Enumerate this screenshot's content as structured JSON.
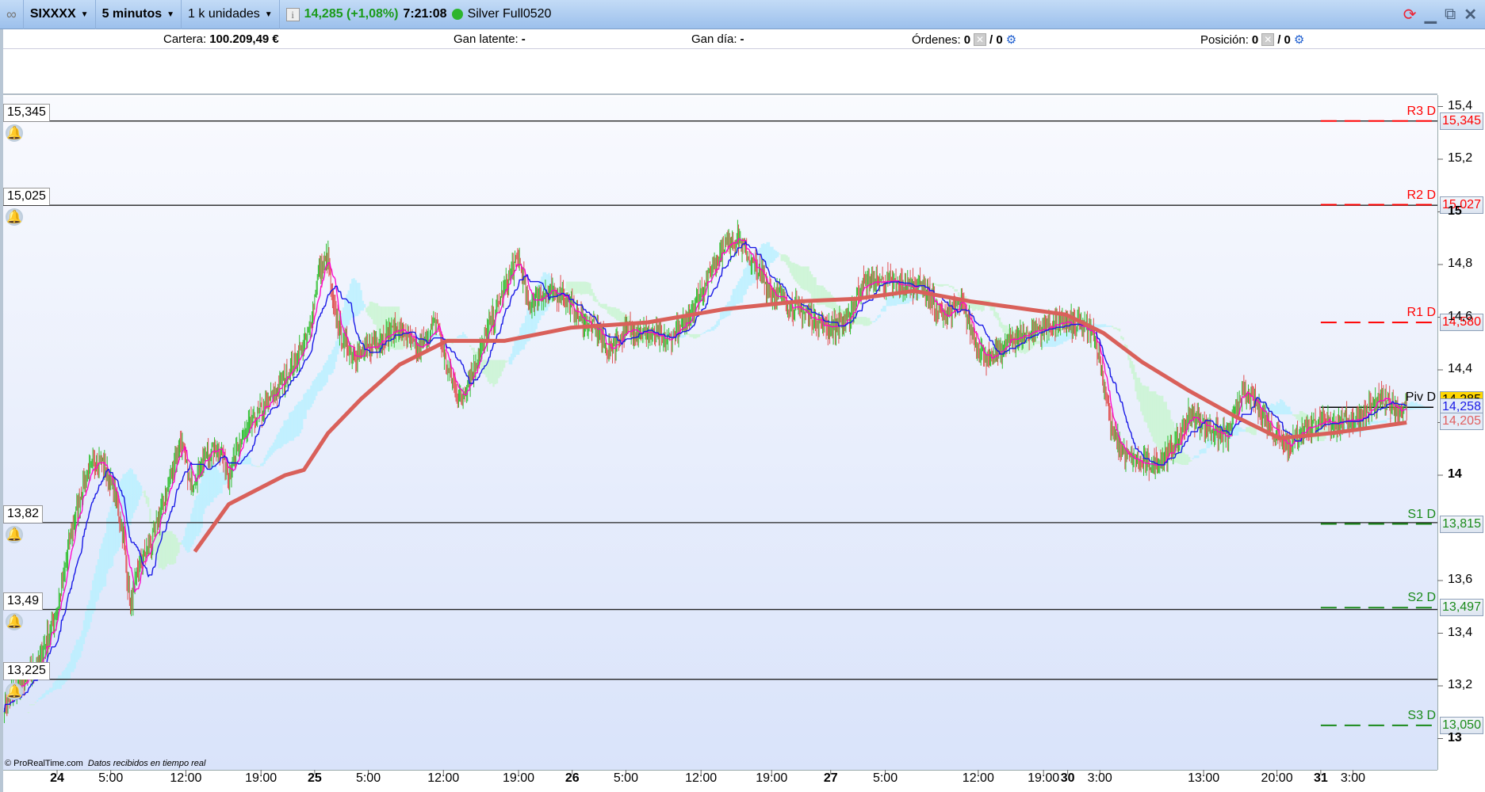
{
  "toolbar": {
    "symbol": "SIXXXX",
    "timeframe": "5 minutos",
    "units": "1 k unidades",
    "price": "14,285 (+1,08%)",
    "time": "7:21:08",
    "account": "Silver Full0520",
    "icons": [
      "link-icon",
      "info-icon",
      "status-dot-icon",
      "refresh-icon",
      "minimize-icon",
      "restore-icon",
      "close-icon"
    ]
  },
  "infobar": {
    "cartera_label": "Cartera:",
    "cartera_value": "100.209,49 €",
    "latente_label": "Gan latente:",
    "latente_value": "-",
    "dia_label": "Gan día:",
    "dia_value": "-",
    "ordenes_label": "Órdenes:",
    "ordenes_value": "0",
    "ordenes_total": "/ 0",
    "posicion_label": "Posición:",
    "posicion_value": "0",
    "posicion_total": "/ 0"
  },
  "footer": {
    "copyright": "© ProRealTime.com",
    "status": "Datos recibidos en tiempo real"
  },
  "colors": {
    "up": "#2fbf2f",
    "down": "#e05050",
    "ma": "#d9605a",
    "tenkan": "#1a1ae6",
    "fast": "#ff00cc",
    "cloud_a": "#b8f0ff",
    "cloud_b": "#c8f5d0",
    "resistance": "#ff0000",
    "support": "#1a8a1a",
    "price_tag": "#ffd700"
  },
  "chart_data": {
    "type": "line",
    "title": "SIXXXX 5 minutos",
    "ylim": [
      12.88,
      15.45
    ],
    "xlim": [
      -60,
      1543
    ],
    "y_ticks": [
      {
        "v": 15.4,
        "l": "15,4"
      },
      {
        "v": 15.2,
        "l": "15,2"
      },
      {
        "v": 15.0,
        "l": "15",
        "b": true
      },
      {
        "v": 14.8,
        "l": "14,8"
      },
      {
        "v": 14.6,
        "l": "14,6"
      },
      {
        "v": 14.4,
        "l": "14,4"
      },
      {
        "v": 14.2,
        "l": "14,2"
      },
      {
        "v": 14.0,
        "l": "14",
        "b": true
      },
      {
        "v": 13.6,
        "l": "13,6"
      },
      {
        "v": 13.4,
        "l": "13,4"
      },
      {
        "v": 13.2,
        "l": "13,2"
      },
      {
        "v": 13.0,
        "l": "13",
        "b": true
      }
    ],
    "x_ticks": [
      {
        "i": 0,
        "l": "24",
        "b": true
      },
      {
        "i": 60,
        "l": "5:00"
      },
      {
        "i": 144,
        "l": "12:00"
      },
      {
        "i": 228,
        "l": "19:00"
      },
      {
        "i": 288,
        "l": "25",
        "b": true
      },
      {
        "i": 348,
        "l": "5:00"
      },
      {
        "i": 432,
        "l": "12:00"
      },
      {
        "i": 516,
        "l": "19:00"
      },
      {
        "i": 576,
        "l": "26",
        "b": true
      },
      {
        "i": 636,
        "l": "5:00"
      },
      {
        "i": 720,
        "l": "12:00"
      },
      {
        "i": 799,
        "l": "19:00"
      },
      {
        "i": 865,
        "l": "27",
        "b": true
      },
      {
        "i": 926,
        "l": "5:00"
      },
      {
        "i": 1030,
        "l": "12:00"
      },
      {
        "i": 1103,
        "l": "19:00"
      },
      {
        "i": 1130,
        "l": "30",
        "b": true
      },
      {
        "i": 1166,
        "l": "3:00"
      },
      {
        "i": 1282,
        "l": "13:00"
      },
      {
        "i": 1364,
        "l": "20:00"
      },
      {
        "i": 1413,
        "l": "31",
        "b": true
      },
      {
        "i": 1449,
        "l": "3:00"
      }
    ],
    "close": [
      [
        -59,
        13.13
      ],
      [
        -21,
        13.28
      ],
      [
        0,
        13.49
      ],
      [
        16,
        13.78
      ],
      [
        32,
        14.0
      ],
      [
        48,
        14.07
      ],
      [
        64,
        13.93
      ],
      [
        74,
        13.78
      ],
      [
        82,
        13.49
      ],
      [
        90,
        13.64
      ],
      [
        106,
        13.75
      ],
      [
        122,
        13.93
      ],
      [
        138,
        14.14
      ],
      [
        149,
        13.96
      ],
      [
        165,
        14.07
      ],
      [
        181,
        14.11
      ],
      [
        192,
        14.0
      ],
      [
        207,
        14.14
      ],
      [
        223,
        14.22
      ],
      [
        245,
        14.32
      ],
      [
        266,
        14.43
      ],
      [
        282,
        14.54
      ],
      [
        292,
        14.76
      ],
      [
        303,
        14.83
      ],
      [
        308,
        14.65
      ],
      [
        319,
        14.51
      ],
      [
        335,
        14.45
      ],
      [
        362,
        14.52
      ],
      [
        383,
        14.56
      ],
      [
        404,
        14.47
      ],
      [
        425,
        14.58
      ],
      [
        436,
        14.4
      ],
      [
        452,
        14.29
      ],
      [
        468,
        14.43
      ],
      [
        489,
        14.61
      ],
      [
        505,
        14.76
      ],
      [
        516,
        14.83
      ],
      [
        527,
        14.65
      ],
      [
        543,
        14.69
      ],
      [
        564,
        14.69
      ],
      [
        580,
        14.61
      ],
      [
        601,
        14.56
      ],
      [
        617,
        14.47
      ],
      [
        638,
        14.56
      ],
      [
        660,
        14.54
      ],
      [
        681,
        14.51
      ],
      [
        702,
        14.58
      ],
      [
        723,
        14.72
      ],
      [
        745,
        14.87
      ],
      [
        761,
        14.9
      ],
      [
        777,
        14.81
      ],
      [
        798,
        14.7
      ],
      [
        819,
        14.65
      ],
      [
        840,
        14.61
      ],
      [
        862,
        14.56
      ],
      [
        883,
        14.58
      ],
      [
        899,
        14.72
      ],
      [
        920,
        14.74
      ],
      [
        947,
        14.72
      ],
      [
        968,
        14.72
      ],
      [
        989,
        14.6
      ],
      [
        1011,
        14.65
      ],
      [
        1027,
        14.51
      ],
      [
        1043,
        14.43
      ],
      [
        1064,
        14.51
      ],
      [
        1085,
        14.54
      ],
      [
        1106,
        14.56
      ],
      [
        1128,
        14.58
      ],
      [
        1144,
        14.56
      ],
      [
        1160,
        14.54
      ],
      [
        1170,
        14.36
      ],
      [
        1181,
        14.14
      ],
      [
        1197,
        14.07
      ],
      [
        1213,
        14.04
      ],
      [
        1229,
        14.04
      ],
      [
        1250,
        14.11
      ],
      [
        1266,
        14.23
      ],
      [
        1287,
        14.18
      ],
      [
        1309,
        14.14
      ],
      [
        1324,
        14.32
      ],
      [
        1340,
        14.27
      ],
      [
        1362,
        14.16
      ],
      [
        1378,
        14.11
      ],
      [
        1394,
        14.18
      ],
      [
        1415,
        14.2
      ],
      [
        1436,
        14.2
      ],
      [
        1458,
        14.22
      ],
      [
        1479,
        14.29
      ],
      [
        1500,
        14.25
      ],
      [
        1509,
        14.26
      ]
    ],
    "moving_average": [
      [
        154,
        13.71
      ],
      [
        192,
        13.89
      ],
      [
        255,
        14.0
      ],
      [
        276,
        14.02
      ],
      [
        303,
        14.16
      ],
      [
        340,
        14.29
      ],
      [
        383,
        14.42
      ],
      [
        436,
        14.51
      ],
      [
        500,
        14.51
      ],
      [
        574,
        14.56
      ],
      [
        660,
        14.58
      ],
      [
        745,
        14.63
      ],
      [
        830,
        14.66
      ],
      [
        894,
        14.67
      ],
      [
        958,
        14.7
      ],
      [
        1021,
        14.66
      ],
      [
        1085,
        14.63
      ],
      [
        1128,
        14.61
      ],
      [
        1170,
        14.54
      ],
      [
        1213,
        14.43
      ],
      [
        1266,
        14.32
      ],
      [
        1319,
        14.22
      ],
      [
        1367,
        14.14
      ],
      [
        1426,
        14.16
      ],
      [
        1468,
        14.18
      ],
      [
        1509,
        14.2
      ]
    ],
    "alert_lines": [
      {
        "v": 15.345,
        "l": "15,345"
      },
      {
        "v": 15.025,
        "l": "15,025"
      },
      {
        "v": 13.82,
        "l": "13,82"
      },
      {
        "v": 13.49,
        "l": "13,49"
      },
      {
        "v": 13.225,
        "l": "13,225"
      }
    ],
    "pivots": [
      {
        "name": "R3 D",
        "v": 15.345,
        "l": "15,345",
        "kind": "r"
      },
      {
        "name": "R2 D",
        "v": 15.027,
        "l": "15,027",
        "kind": "r"
      },
      {
        "name": "R1 D",
        "v": 14.58,
        "l": "14,580",
        "kind": "r"
      },
      {
        "name": "Piv D",
        "v": 14.258,
        "l": "",
        "kind": "p"
      },
      {
        "name": "S1 D",
        "v": 13.815,
        "l": "13,815",
        "kind": "s"
      },
      {
        "name": "S2 D",
        "v": 13.497,
        "l": "13,497",
        "kind": "s"
      },
      {
        "name": "S3 D",
        "v": 13.05,
        "l": "13,050",
        "kind": "s"
      }
    ],
    "pivot_start_index": 1413,
    "price_tags": [
      {
        "v": 14.285,
        "l": "14,285",
        "bg": "#ffd700",
        "fg": "#000"
      },
      {
        "v": 14.258,
        "l": "14,258",
        "bg": "#e4ecf8",
        "fg": "#1a1ae6"
      },
      {
        "v": 14.205,
        "l": "14,205",
        "bg": "#e4ecf8",
        "fg": "#e06060"
      }
    ]
  }
}
